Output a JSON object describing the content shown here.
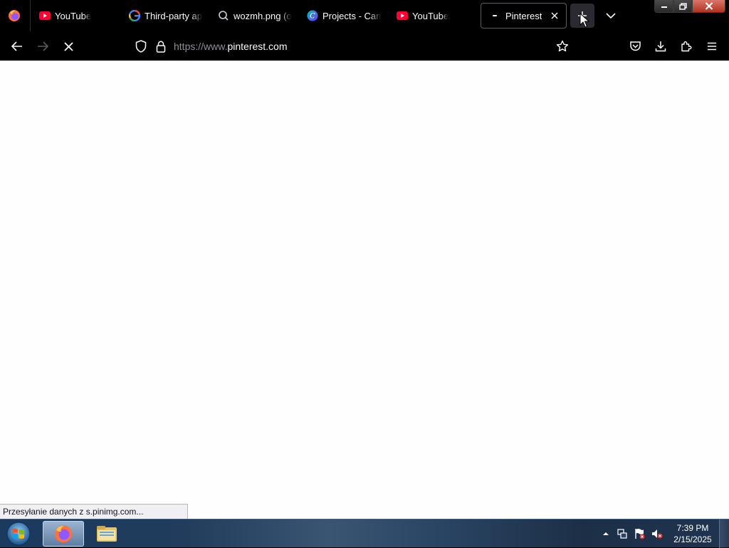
{
  "browser": {
    "tabs": [
      {
        "title": "YouTube",
        "favicon": "youtube-icon",
        "active": false
      },
      {
        "title": "Third-party app",
        "favicon": "google-icon",
        "active": false
      },
      {
        "title": "wozmh.png (o",
        "favicon": "search-magnifier-icon",
        "active": false
      },
      {
        "title": "Projects - Canva",
        "favicon": "canva-icon",
        "active": false
      },
      {
        "title": "YouTube",
        "favicon": "youtube-icon",
        "active": false
      },
      {
        "title": "Pinterest",
        "favicon": "loading-icon",
        "active": true
      }
    ],
    "new_tab_label": "+",
    "url": {
      "prefix": "https://www.",
      "host": "pinterest.com"
    },
    "status_text": "Przesyłanie danych z s.pinimg.com..."
  },
  "taskbar": {
    "clock_time": "7:39 PM",
    "clock_date": "2/15/2025"
  },
  "colors": {
    "toolbar_bg": "#000000",
    "tab_text": "#fbfbfe",
    "url_prefix": "#8f8f9d",
    "content_bg": "#fffefe",
    "youtube_red": "#ff0033"
  }
}
